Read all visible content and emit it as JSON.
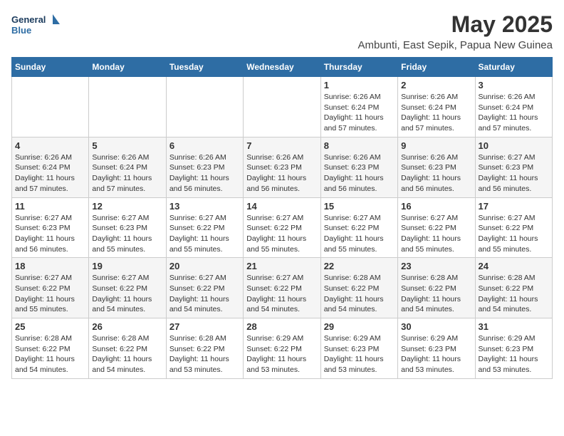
{
  "logo": {
    "line1": "General",
    "line2": "Blue"
  },
  "title": "May 2025",
  "location": "Ambunti, East Sepik, Papua New Guinea",
  "days_of_week": [
    "Sunday",
    "Monday",
    "Tuesday",
    "Wednesday",
    "Thursday",
    "Friday",
    "Saturday"
  ],
  "weeks": [
    [
      {
        "day": "",
        "info": ""
      },
      {
        "day": "",
        "info": ""
      },
      {
        "day": "",
        "info": ""
      },
      {
        "day": "",
        "info": ""
      },
      {
        "day": "1",
        "info": "Sunrise: 6:26 AM\nSunset: 6:24 PM\nDaylight: 11 hours and 57 minutes."
      },
      {
        "day": "2",
        "info": "Sunrise: 6:26 AM\nSunset: 6:24 PM\nDaylight: 11 hours and 57 minutes."
      },
      {
        "day": "3",
        "info": "Sunrise: 6:26 AM\nSunset: 6:24 PM\nDaylight: 11 hours and 57 minutes."
      }
    ],
    [
      {
        "day": "4",
        "info": "Sunrise: 6:26 AM\nSunset: 6:24 PM\nDaylight: 11 hours and 57 minutes."
      },
      {
        "day": "5",
        "info": "Sunrise: 6:26 AM\nSunset: 6:24 PM\nDaylight: 11 hours and 57 minutes."
      },
      {
        "day": "6",
        "info": "Sunrise: 6:26 AM\nSunset: 6:23 PM\nDaylight: 11 hours and 56 minutes."
      },
      {
        "day": "7",
        "info": "Sunrise: 6:26 AM\nSunset: 6:23 PM\nDaylight: 11 hours and 56 minutes."
      },
      {
        "day": "8",
        "info": "Sunrise: 6:26 AM\nSunset: 6:23 PM\nDaylight: 11 hours and 56 minutes."
      },
      {
        "day": "9",
        "info": "Sunrise: 6:26 AM\nSunset: 6:23 PM\nDaylight: 11 hours and 56 minutes."
      },
      {
        "day": "10",
        "info": "Sunrise: 6:27 AM\nSunset: 6:23 PM\nDaylight: 11 hours and 56 minutes."
      }
    ],
    [
      {
        "day": "11",
        "info": "Sunrise: 6:27 AM\nSunset: 6:23 PM\nDaylight: 11 hours and 56 minutes."
      },
      {
        "day": "12",
        "info": "Sunrise: 6:27 AM\nSunset: 6:23 PM\nDaylight: 11 hours and 55 minutes."
      },
      {
        "day": "13",
        "info": "Sunrise: 6:27 AM\nSunset: 6:22 PM\nDaylight: 11 hours and 55 minutes."
      },
      {
        "day": "14",
        "info": "Sunrise: 6:27 AM\nSunset: 6:22 PM\nDaylight: 11 hours and 55 minutes."
      },
      {
        "day": "15",
        "info": "Sunrise: 6:27 AM\nSunset: 6:22 PM\nDaylight: 11 hours and 55 minutes."
      },
      {
        "day": "16",
        "info": "Sunrise: 6:27 AM\nSunset: 6:22 PM\nDaylight: 11 hours and 55 minutes."
      },
      {
        "day": "17",
        "info": "Sunrise: 6:27 AM\nSunset: 6:22 PM\nDaylight: 11 hours and 55 minutes."
      }
    ],
    [
      {
        "day": "18",
        "info": "Sunrise: 6:27 AM\nSunset: 6:22 PM\nDaylight: 11 hours and 55 minutes."
      },
      {
        "day": "19",
        "info": "Sunrise: 6:27 AM\nSunset: 6:22 PM\nDaylight: 11 hours and 54 minutes."
      },
      {
        "day": "20",
        "info": "Sunrise: 6:27 AM\nSunset: 6:22 PM\nDaylight: 11 hours and 54 minutes."
      },
      {
        "day": "21",
        "info": "Sunrise: 6:27 AM\nSunset: 6:22 PM\nDaylight: 11 hours and 54 minutes."
      },
      {
        "day": "22",
        "info": "Sunrise: 6:28 AM\nSunset: 6:22 PM\nDaylight: 11 hours and 54 minutes."
      },
      {
        "day": "23",
        "info": "Sunrise: 6:28 AM\nSunset: 6:22 PM\nDaylight: 11 hours and 54 minutes."
      },
      {
        "day": "24",
        "info": "Sunrise: 6:28 AM\nSunset: 6:22 PM\nDaylight: 11 hours and 54 minutes."
      }
    ],
    [
      {
        "day": "25",
        "info": "Sunrise: 6:28 AM\nSunset: 6:22 PM\nDaylight: 11 hours and 54 minutes."
      },
      {
        "day": "26",
        "info": "Sunrise: 6:28 AM\nSunset: 6:22 PM\nDaylight: 11 hours and 54 minutes."
      },
      {
        "day": "27",
        "info": "Sunrise: 6:28 AM\nSunset: 6:22 PM\nDaylight: 11 hours and 53 minutes."
      },
      {
        "day": "28",
        "info": "Sunrise: 6:29 AM\nSunset: 6:22 PM\nDaylight: 11 hours and 53 minutes."
      },
      {
        "day": "29",
        "info": "Sunrise: 6:29 AM\nSunset: 6:23 PM\nDaylight: 11 hours and 53 minutes."
      },
      {
        "day": "30",
        "info": "Sunrise: 6:29 AM\nSunset: 6:23 PM\nDaylight: 11 hours and 53 minutes."
      },
      {
        "day": "31",
        "info": "Sunrise: 6:29 AM\nSunset: 6:23 PM\nDaylight: 11 hours and 53 minutes."
      }
    ]
  ]
}
